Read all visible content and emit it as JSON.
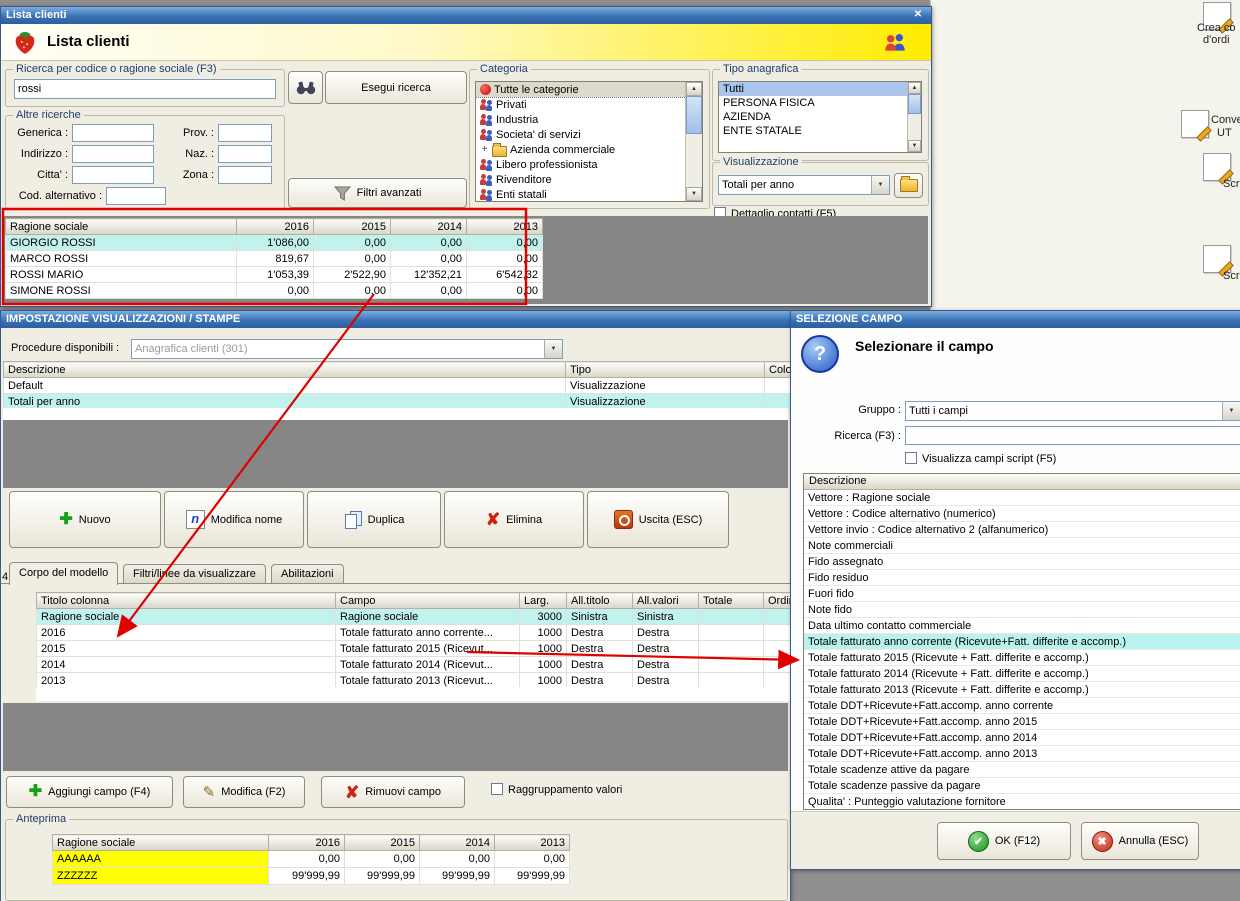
{
  "icons": {
    "close": "✕",
    "arrow_down": "▼",
    "arrow_up": "▲",
    "help": "?",
    "check": "✔",
    "cross": "✖",
    "plus": "✚",
    "delete": "✘",
    "pencil": "✎",
    "letter_n": "n"
  },
  "colors": {
    "annotation": "#e00000",
    "selection_cyan": "#b9f2ee",
    "selection_blue": "#aac6ea",
    "preview_yellow": "#ffff00"
  },
  "lista": {
    "title": "Lista clienti",
    "header_title": "Lista clienti",
    "search_group": "Ricerca per codice o ragione sociale (F3)",
    "search_value": "rossi",
    "esegui_ricerca": "Esegui ricerca",
    "altre_group": "Altre ricerche",
    "labels": {
      "generica": "Generica :",
      "prov": "Prov. :",
      "indirizzo": "Indirizzo :",
      "naz": "Naz. :",
      "citta": "Citta' :",
      "zona": "Zona :",
      "cod_alt": "Cod. alternativo :"
    },
    "filtri_avanzati": "Filtri avanzati",
    "categoria_group": "Categoria",
    "categoria_items": [
      {
        "icon": "categories-root-icon",
        "label": "Tutte le categorie",
        "selected": true
      },
      {
        "icon": "people-icon",
        "label": "Privati"
      },
      {
        "icon": "people-icon",
        "label": "Industria"
      },
      {
        "icon": "people-icon",
        "label": "Societa' di servizi"
      },
      {
        "icon": "folder-icon",
        "label": "Azienda commerciale",
        "expand": "+"
      },
      {
        "icon": "people-icon",
        "label": "Libero professionista"
      },
      {
        "icon": "people-icon",
        "label": "Rivenditore"
      },
      {
        "icon": "people-icon",
        "label": "Enti statali"
      }
    ],
    "tipo_group": "Tipo anagrafica",
    "tipo_items": [
      "Tutti",
      "PERSONA FISICA",
      "AZIENDA",
      "ENTE STATALE"
    ],
    "visualizzazione_group": "Visualizzazione",
    "visualizzazione_value": "Totali per anno",
    "dettaglio_checkbox": "Dettaglio contatti (F5)",
    "results": {
      "columns": [
        "Ragione sociale",
        "2016",
        "2015",
        "2014",
        "2013"
      ],
      "rows": [
        [
          "GIORGIO ROSSI",
          "1'086,00",
          "0,00",
          "0,00",
          "0,00"
        ],
        [
          "MARCO ROSSI",
          "819,67",
          "0,00",
          "0,00",
          "0,00"
        ],
        [
          "ROSSI MARIO",
          "1'053,39",
          "2'522,90",
          "12'352,21",
          "6'542,32"
        ],
        [
          "SIMONE ROSSI",
          "0,00",
          "0,00",
          "0,00",
          "0,00"
        ]
      ]
    }
  },
  "impo": {
    "title": "IMPOSTAZIONE VISUALIZZAZIONI / STAMPE",
    "procedure_label": "Procedure disponibili :",
    "procedure_value": "Anagrafica clienti (301)",
    "views": {
      "columns": [
        "Descrizione",
        "Tipo",
        "Color..."
      ],
      "rows": [
        [
          "Default",
          "Visualizzazione",
          ""
        ],
        [
          "Totali per anno",
          "Visualizzazione",
          ""
        ]
      ]
    },
    "buttons": {
      "nuovo": "Nuovo",
      "modifica_nome": "Modifica nome",
      "duplica": "Duplica",
      "elimina": "Elimina",
      "uscita": "Uscita (ESC)"
    },
    "tabs": [
      "Corpo del modello",
      "Filtri/linee da visualizzare",
      "Abilitazioni"
    ],
    "model": {
      "columns": [
        "Titolo colonna",
        "Campo",
        "Larg.",
        "All.titolo",
        "All.valori",
        "Totale",
        "Ordinamento"
      ],
      "rows": [
        [
          "Ragione sociale",
          "Ragione sociale",
          "3000",
          "Sinistra",
          "Sinistra",
          "",
          ""
        ],
        [
          "2016",
          "Totale fatturato anno corrente...",
          "1000",
          "Destra",
          "Destra",
          "",
          ""
        ],
        [
          "2015",
          "Totale fatturato 2015 (Ricevut...",
          "1000",
          "Destra",
          "Destra",
          "",
          ""
        ],
        [
          "2014",
          "Totale fatturato 2014 (Ricevut...",
          "1000",
          "Destra",
          "Destra",
          "",
          ""
        ],
        [
          "2013",
          "Totale fatturato 2013 (Ricevut...",
          "1000",
          "Destra",
          "Destra",
          "",
          ""
        ]
      ]
    },
    "aggiungi_campo": "Aggiungi campo (F4)",
    "modifica": "Modifica (F2)",
    "rimuovi_campo": "Rimuovi campo",
    "raggruppamento_checkbox": "Raggruppamento valori",
    "anteprima_group": "Anteprima",
    "anteprima": {
      "columns": [
        "Ragione sociale",
        "2016",
        "2015",
        "2014",
        "2013"
      ],
      "rows": [
        [
          "AAAAAA",
          "0,00",
          "0,00",
          "0,00",
          "0,00"
        ],
        [
          "ZZZZZZ",
          "99'999,99",
          "99'999,99",
          "99'999,99",
          "99'999,99"
        ]
      ]
    },
    "row_indicator": "4"
  },
  "sel": {
    "title": "SELEZIONE CAMPO",
    "heading": "Selezionare il campo",
    "gruppo_label": "Gruppo :",
    "gruppo_value": "Tutti i campi",
    "ricerca_label": "Ricerca (F3) :",
    "script_checkbox": "Visualizza campi script (F5)",
    "list_header": "Descrizione",
    "items": [
      "Vettore : Ragione sociale",
      "Vettore : Codice alternativo (numerico)",
      "Vettore invio : Codice alternativo 2 (alfanumerico)",
      "Note commerciali",
      "Fido assegnato",
      "Fido residuo",
      "Fuori fido",
      "Note fido",
      "Data ultimo contatto commerciale",
      "Totale fatturato anno corrente (Ricevute+Fatt. differite e accomp.)",
      "Totale fatturato 2015 (Ricevute + Fatt. differite e accomp.)",
      "Totale fatturato 2014 (Ricevute + Fatt. differite e accomp.)",
      "Totale fatturato 2013 (Ricevute + Fatt. differite e accomp.)",
      "Totale DDT+Ricevute+Fatt.accomp. anno corrente",
      "Totale DDT+Ricevute+Fatt.accomp. anno 2015",
      "Totale DDT+Ricevute+Fatt.accomp. anno 2014",
      "Totale DDT+Ricevute+Fatt.accomp. anno 2013",
      "Totale scadenze attive da pagare",
      "Totale scadenze passive da pagare",
      "Qualita' : Punteggio valutazione fornitore"
    ],
    "ok": "OK (F12)",
    "annulla": "Annulla (ESC)"
  },
  "side": {
    "items": [
      {
        "line1": "Crea co",
        "line2": "d'ordi"
      },
      {
        "line1": "Conversi",
        "line2": "UT"
      },
      {
        "line1": "Scri",
        "line2": ""
      },
      {
        "line1": "Scri",
        "line2": ""
      }
    ]
  }
}
